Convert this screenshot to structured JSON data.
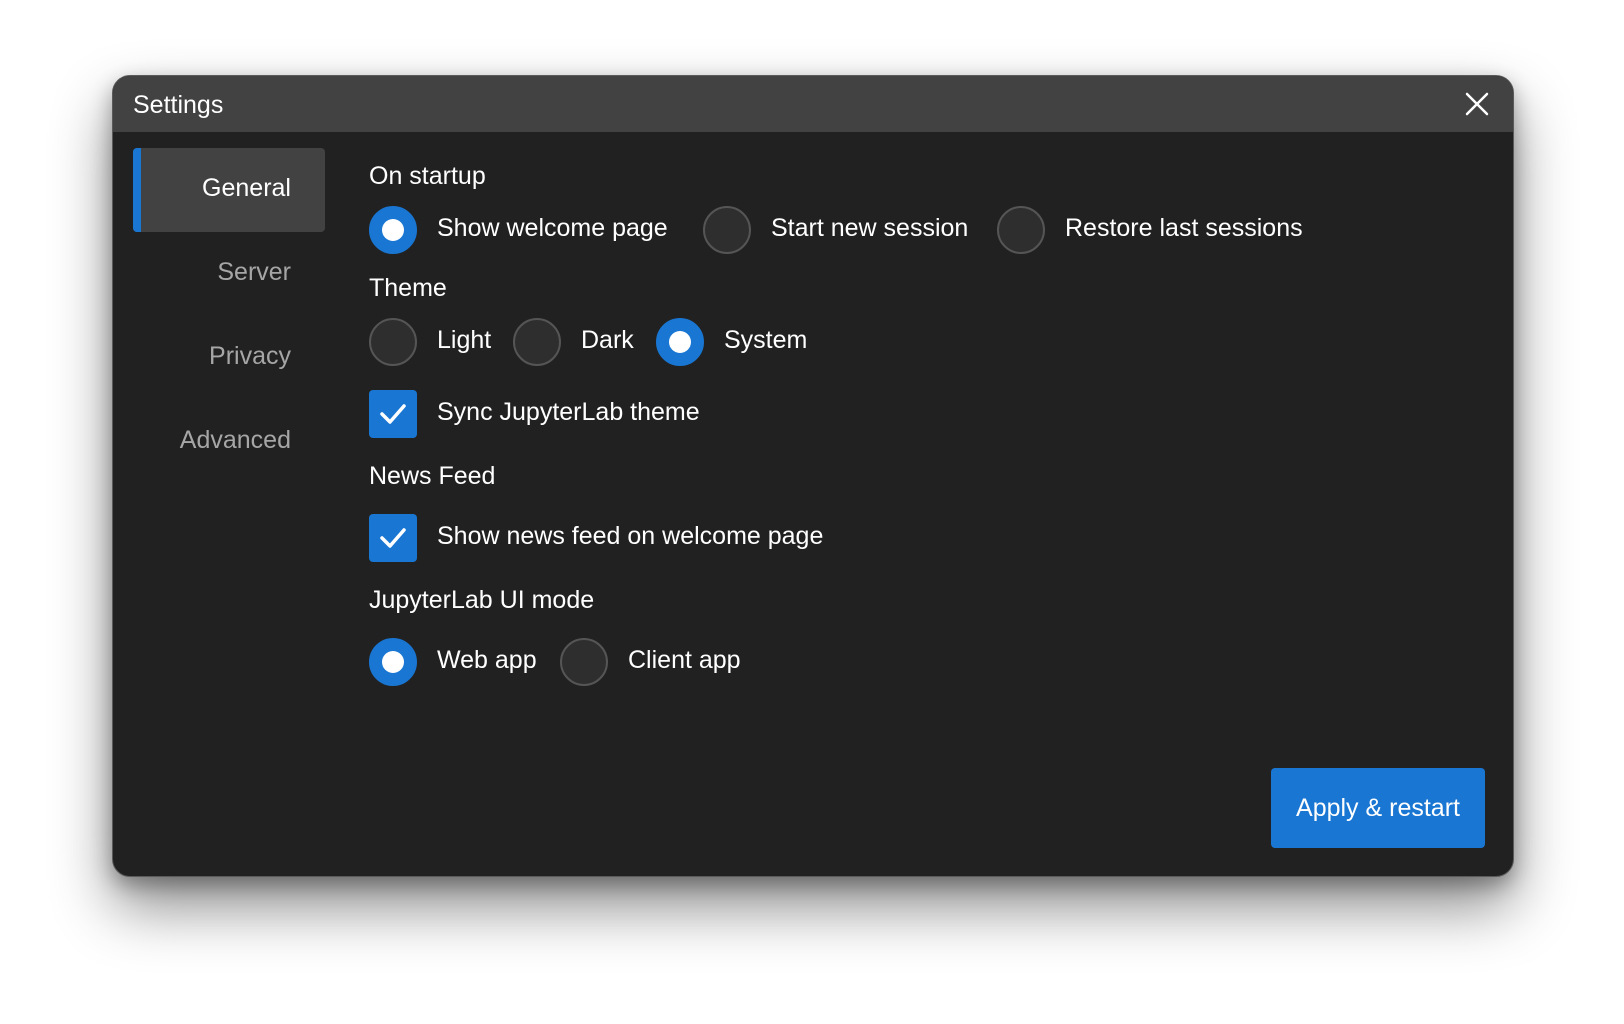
{
  "window": {
    "title": "Settings",
    "close_icon": "close-icon"
  },
  "sidebar": {
    "items": [
      {
        "label": "General",
        "active": true
      },
      {
        "label": "Server",
        "active": false
      },
      {
        "label": "Privacy",
        "active": false
      },
      {
        "label": "Advanced",
        "active": false
      }
    ]
  },
  "sections": {
    "startup": {
      "title": "On startup",
      "options": [
        {
          "label": "Show welcome page",
          "checked": true
        },
        {
          "label": "Start new session",
          "checked": false
        },
        {
          "label": "Restore last sessions",
          "checked": false
        }
      ]
    },
    "theme": {
      "title": "Theme",
      "options": [
        {
          "label": "Light",
          "checked": false
        },
        {
          "label": "Dark",
          "checked": false
        },
        {
          "label": "System",
          "checked": true
        }
      ],
      "sync_label": "Sync JupyterLab theme",
      "sync_checked": true
    },
    "news_feed": {
      "title": "News Feed",
      "show_label": "Show news feed on welcome page",
      "show_checked": true
    },
    "ui_mode": {
      "title": "JupyterLab UI mode",
      "options": [
        {
          "label": "Web app",
          "checked": true
        },
        {
          "label": "Client app",
          "checked": false
        }
      ]
    }
  },
  "footer": {
    "apply_label": "Apply & restart"
  },
  "colors": {
    "accent": "#1976d2",
    "background": "#212121",
    "titlebar": "#424242"
  }
}
